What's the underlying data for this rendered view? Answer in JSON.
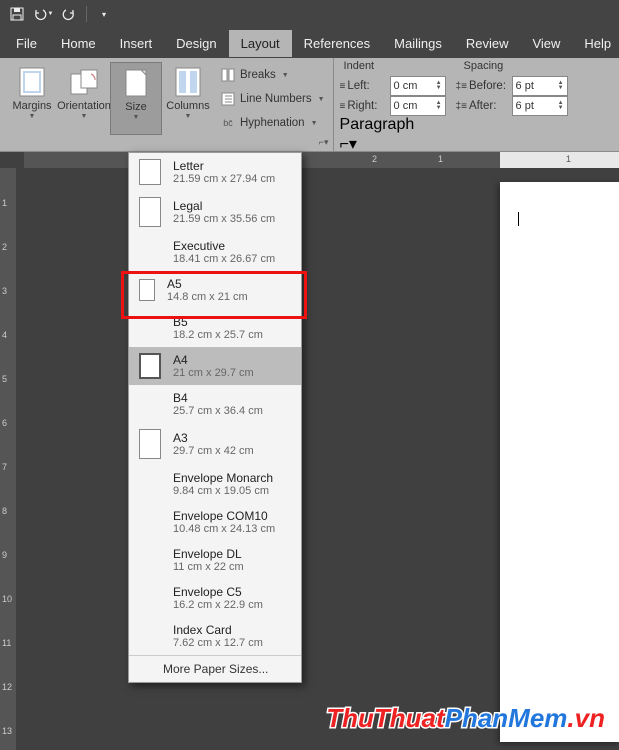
{
  "titlebar": {
    "save_icon": "save",
    "undo_icon": "undo",
    "redo_icon": "redo"
  },
  "menubar": {
    "items": [
      {
        "label": "File"
      },
      {
        "label": "Home"
      },
      {
        "label": "Insert"
      },
      {
        "label": "Design"
      },
      {
        "label": "Layout"
      },
      {
        "label": "References"
      },
      {
        "label": "Mailings"
      },
      {
        "label": "Review"
      },
      {
        "label": "View"
      },
      {
        "label": "Help"
      }
    ],
    "active_index": 4
  },
  "ribbon": {
    "page_setup": {
      "margins_label": "Margins",
      "orientation_label": "Orientation",
      "size_label": "Size",
      "columns_label": "Columns",
      "breaks_label": "Breaks",
      "line_numbers_label": "Line Numbers",
      "hyphenation_label": "Hyphenation"
    },
    "indent_spacing": {
      "indent_header": "Indent",
      "spacing_header": "Spacing",
      "left_label": "Left:",
      "right_label": "Right:",
      "before_label": "Before:",
      "after_label": "After:",
      "left_value": "0 cm",
      "right_value": "0 cm",
      "before_value": "6 pt",
      "after_value": "6 pt",
      "group_label": "Paragraph"
    }
  },
  "size_menu": {
    "items": [
      {
        "name": "Letter",
        "dim": "21.59 cm x 27.94 cm",
        "thumb": true
      },
      {
        "name": "Legal",
        "dim": "21.59 cm x 35.56 cm",
        "thumb": true
      },
      {
        "name": "Executive",
        "dim": "18.41 cm x 26.67 cm",
        "thumb": false
      },
      {
        "name": "A5",
        "dim": "14.8 cm x 21 cm",
        "thumb": true
      },
      {
        "name": "B5",
        "dim": "18.2 cm x 25.7 cm",
        "thumb": false
      },
      {
        "name": "A4",
        "dim": "21 cm x 29.7 cm",
        "thumb": true
      },
      {
        "name": "B4",
        "dim": "25.7 cm x 36.4 cm",
        "thumb": false
      },
      {
        "name": "A3",
        "dim": "29.7 cm x 42 cm",
        "thumb": true
      },
      {
        "name": "Envelope Monarch",
        "dim": "9.84 cm x 19.05 cm",
        "thumb": false
      },
      {
        "name": "Envelope COM10",
        "dim": "10.48 cm x 24.13 cm",
        "thumb": false
      },
      {
        "name": "Envelope DL",
        "dim": "11 cm x 22 cm",
        "thumb": false
      },
      {
        "name": "Envelope C5",
        "dim": "16.2 cm x 22.9 cm",
        "thumb": false
      },
      {
        "name": "Index Card",
        "dim": "7.62 cm x 12.7 cm",
        "thumb": false
      }
    ],
    "selected_index": 5,
    "highlighted_index": 3,
    "more_label": "More Paper Sizes..."
  },
  "ruler_v": {
    "ticks": [
      "1",
      "2",
      "3",
      "4",
      "5",
      "6",
      "7",
      "8",
      "9",
      "10",
      "11",
      "12",
      "13"
    ]
  },
  "ruler_h": {
    "marks": [
      "2",
      "1",
      "1"
    ]
  },
  "watermark": {
    "p1": "ThuThuat",
    "p2": "PhanMem",
    "p3": ".vn"
  }
}
